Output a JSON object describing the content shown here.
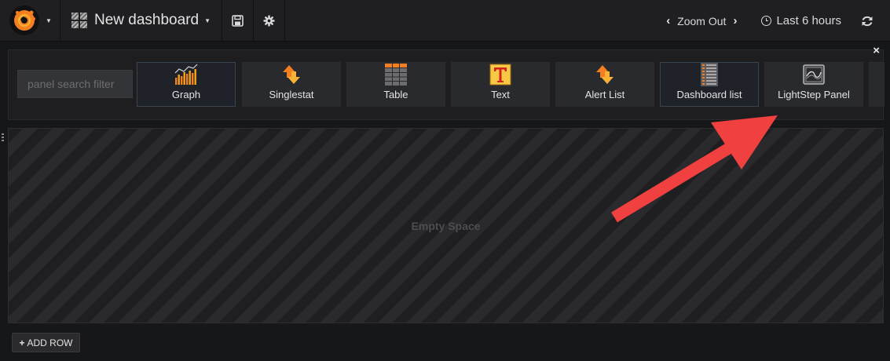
{
  "navbar": {
    "dashboard_title": "New dashboard",
    "zoom_out_label": "Zoom Out",
    "time_range_label": "Last 6 hours"
  },
  "picker": {
    "search_placeholder": "panel search filter",
    "close_symbol": "×",
    "panels": [
      {
        "label": "Graph",
        "icon": "graph-icon",
        "selected": true
      },
      {
        "label": "Singlestat",
        "icon": "singlestat-icon",
        "selected": false
      },
      {
        "label": "Table",
        "icon": "table-icon",
        "selected": false
      },
      {
        "label": "Text",
        "icon": "text-icon",
        "selected": false
      },
      {
        "label": "Alert List",
        "icon": "alert-list-icon",
        "selected": false
      },
      {
        "label": "Dashboard list",
        "icon": "dashboard-list-icon",
        "selected": true
      },
      {
        "label": "LightStep Panel",
        "icon": "lightstep-icon",
        "selected": false
      }
    ]
  },
  "row": {
    "empty_label": "Empty Space"
  },
  "footer": {
    "add_row_label": "ADD ROW"
  },
  "colors": {
    "background": "#161719",
    "accent_orange": "#f47f20",
    "annotation_arrow": "#f0403f"
  }
}
